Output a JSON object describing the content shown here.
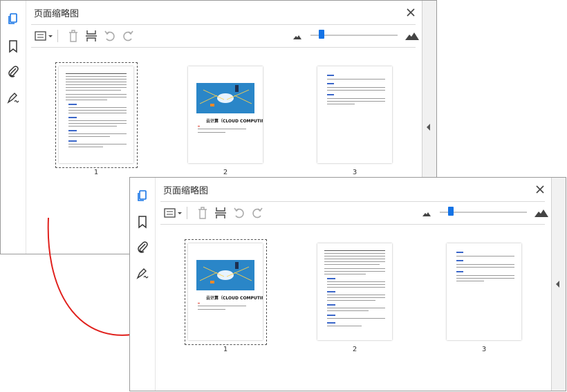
{
  "panel_title": "页面缩略图",
  "page_numbers": [
    "1",
    "2",
    "3"
  ],
  "cloud_page_title": "云计算（CLOUD COMPUTING）",
  "colors": {
    "accent": "#1473e6",
    "arrow": "#e0201c",
    "image_blue": "#2a86c8"
  },
  "icons": [
    "page-thumbnails-icon",
    "bookmark-icon",
    "attachment-icon",
    "signature-icon",
    "options-icon",
    "delete-icon",
    "insert-page-icon",
    "rotate-ccw-icon",
    "rotate-cw-icon",
    "zoom-small-icon",
    "zoom-large-icon",
    "close-icon"
  ]
}
